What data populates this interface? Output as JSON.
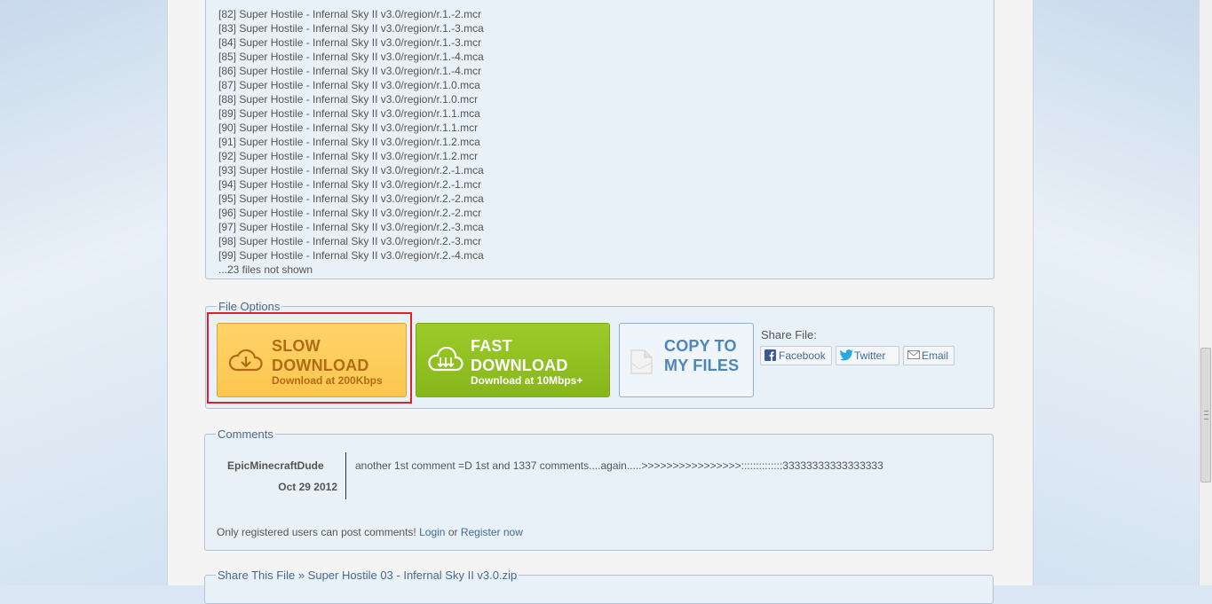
{
  "file_list": {
    "files": [
      "[82] Super Hostile - Infernal Sky II v3.0/region/r.1.-2.mcr",
      "[83] Super Hostile - Infernal Sky II v3.0/region/r.1.-3.mca",
      "[84] Super Hostile - Infernal Sky II v3.0/region/r.1.-3.mcr",
      "[85] Super Hostile - Infernal Sky II v3.0/region/r.1.-4.mca",
      "[86] Super Hostile - Infernal Sky II v3.0/region/r.1.-4.mcr",
      "[87] Super Hostile - Infernal Sky II v3.0/region/r.1.0.mca",
      "[88] Super Hostile - Infernal Sky II v3.0/region/r.1.0.mcr",
      "[89] Super Hostile - Infernal Sky II v3.0/region/r.1.1.mca",
      "[90] Super Hostile - Infernal Sky II v3.0/region/r.1.1.mcr",
      "[91] Super Hostile - Infernal Sky II v3.0/region/r.1.2.mca",
      "[92] Super Hostile - Infernal Sky II v3.0/region/r.1.2.mcr",
      "[93] Super Hostile - Infernal Sky II v3.0/region/r.2.-1.mca",
      "[94] Super Hostile - Infernal Sky II v3.0/region/r.2.-1.mcr",
      "[95] Super Hostile - Infernal Sky II v3.0/region/r.2.-2.mca",
      "[96] Super Hostile - Infernal Sky II v3.0/region/r.2.-2.mcr",
      "[97] Super Hostile - Infernal Sky II v3.0/region/r.2.-3.mca",
      "[98] Super Hostile - Infernal Sky II v3.0/region/r.2.-3.mcr",
      "[99] Super Hostile - Infernal Sky II v3.0/region/r.2.-4.mca"
    ],
    "not_shown": "...23 files not shown"
  },
  "file_options": {
    "legend": "File Options",
    "slow": {
      "title_line1": "SLOW",
      "title_line2": "DOWNLOAD",
      "subtitle": "Download at 200Kbps",
      "icon": "cloud-download-icon"
    },
    "fast": {
      "title_line1": "FAST",
      "title_line2": "DOWNLOAD",
      "subtitle": "Download at 10Mbps+",
      "icon": "cloud-download-icon"
    },
    "copy": {
      "title_line1": "COPY TO",
      "title_line2": "MY FILES",
      "icon": "document-icon"
    },
    "share_label": "Share File:",
    "share_buttons": {
      "facebook": "Facebook",
      "twitter": "Twitter",
      "email": "Email"
    },
    "colors": {
      "slow": "#fbc64e",
      "fast": "#8cbc1f",
      "copy": "#eef5fb",
      "highlight": "#e0202a"
    }
  },
  "comments": {
    "legend": "Comments",
    "items": [
      {
        "author": "EpicMinecraftDude",
        "date": "Oct 29 2012",
        "text": "another 1st comment =D 1st and 1337 comments....again.....>>>>>>>>>>>>>>>>::::::::::::::33333333333333333"
      }
    ],
    "note_prefix": "Only registered users can post comments!",
    "login_label": "Login",
    "or_label": "or",
    "register_label": "Register now"
  },
  "share_box": {
    "legend_prefix": "Share This File",
    "separator": "»",
    "filename": "Super Hostile 03 - Infernal Sky II v3.0.zip"
  }
}
